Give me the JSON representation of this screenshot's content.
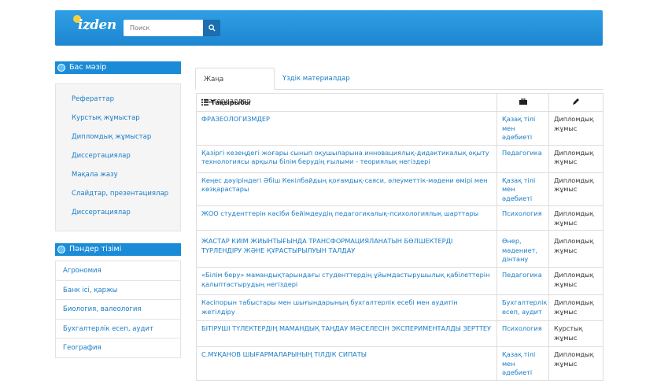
{
  "header": {
    "logo_text": "izden",
    "search_placeholder": "Поиск",
    "icons": {
      "search": "magnifier-icon"
    }
  },
  "colors": {
    "header": "#1d86d1",
    "link": "#1a7cc5",
    "accent_dark": "#1b6fb0"
  },
  "sidebar": {
    "main_menu_title": "Бас мәзір",
    "main_menu_items": [
      "Рефераттар",
      "Курстық жұмыстар",
      "Дипломдық жұмыстар",
      "Диссертациялар",
      "Мақала жазу",
      "Слайдтар, презентациялар",
      "Диссертациялар"
    ],
    "subjects_title": "Пәндер тізімі",
    "subjects": [
      "Агрономия",
      "Банк ісі, қаржы",
      "Биология, валеология",
      "Бухгалтерлік есеп, аудит",
      "География"
    ]
  },
  "tabs": [
    "Жаңа материалдар",
    "Үздік материалдар"
  ],
  "table": {
    "header_title": "Тақырыбы",
    "icons": {
      "list": "list-icon",
      "subject": "briefcase-icon",
      "type": "pencil-icon"
    },
    "rows": [
      {
        "title": "ФРАЗЕОЛОГИЗМДЕР",
        "subject": "Қазақ тілі мен әдебиеті",
        "type": "Дипломдық жұмыс"
      },
      {
        "title": "Қазіргі кезеңдегі жоғары сынып оқушыларына инновациялық-дидактикалық оқыту технологиясы арқылы білім берудің ғылыми - теориялық негіздері",
        "subject": "Педагогика",
        "type": "Дипломдық жұмыс"
      },
      {
        "title": "Кеңес дәуіріндегі Әбіш Кекілбайдың қоғамдық-саяси, әлеуметтік-мәдени өмірі мен көзқарастары",
        "subject": "Қазақ тілі мен әдебиеті",
        "type": "Дипломдық жұмыс"
      },
      {
        "title": "ЖОО студенттерін кәсіби бейімдеудің педагогикалық-психологиялық шарттары",
        "subject": "Психология",
        "type": "Дипломдық жұмыс"
      },
      {
        "title": "ЖАСТАР КИІМ ЖИЫНТЫҒЫНДА ТРАНСФОРМАЦИЯЛАНАТЫН БӨЛШЕКТЕРДІ ТҮРЛЕНДІРУ ЖӘНЕ ҚҰРАСТЫРЫЛУЫН ТАЛДАУ",
        "subject": "Өнер, мәдениет, дінтану",
        "type": "Дипломдық жұмыс"
      },
      {
        "title": "«Білім беру» мамандықтарындағы студенттердің ұйымдастырушылық қабілеттерін қалыптастырудың негіздері",
        "subject": "Педагогика",
        "type": "Дипломдық жұмыс"
      },
      {
        "title": "Кәсіпорын табыстары мен шығындарының бухгалтерлік есебі мен аудитін жетілдіру",
        "subject": "Бухгалтерлік есеп, аудит",
        "type": "Дипломдық жұмыс"
      },
      {
        "title": "БІТІРУШІ ТҮЛЕКТЕРДІҢ МАМАНДЫҚ ТАҢДАУ МӘСЕЛЕСІН ЭКСПЕРИМЕНТАЛДЫ ЗЕРТТЕУ",
        "subject": "Психология",
        "type": "Курстық жұмыс"
      },
      {
        "title": "С.МҰҚАНОВ ШЫҒАРМАЛАРЫНЫҢ ТІЛДІК СИПАТЫ",
        "subject": "Қазақ тілі мен әдебиеті",
        "type": "Дипломдық жұмыс"
      }
    ]
  }
}
